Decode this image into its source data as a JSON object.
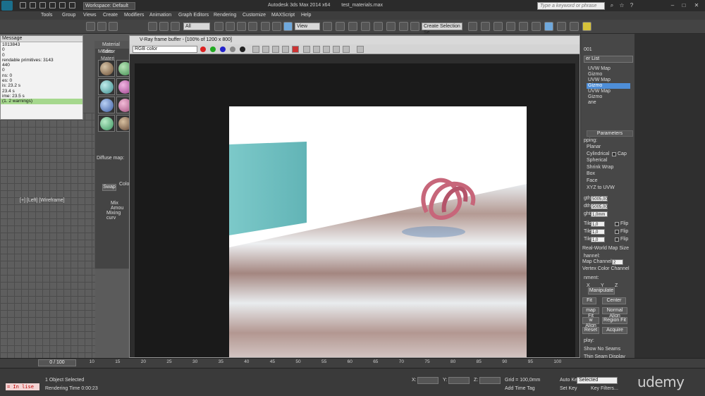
{
  "titlebar": {
    "workspace": "Workspace: Default",
    "title": "Autodesk 3ds Max 2014 x64",
    "file": "test_materials.max",
    "search_placeholder": "Type a keyword or phrase"
  },
  "menu": [
    "Tools",
    "Group",
    "Views",
    "Create",
    "Modifiers",
    "Animation",
    "Graph Editors",
    "Rendering",
    "Customize",
    "MAXScript",
    "Help"
  ],
  "toolbar": {
    "filter": "All",
    "ref_coord": "View",
    "selection_set": "Create Selection Se"
  },
  "message_window": {
    "title": "Message",
    "lines": [
      "1013843",
      "0",
      "0",
      "rendable primitives: 3143",
      "440",
      "0",
      "ns: 0",
      "es: 0",
      "is: 23.2 s",
      "23.4 s",
      "ime: 23.5 s",
      "(1. 2 warnings)"
    ],
    "highlight_index": 11
  },
  "material_editor": {
    "title": "Material Editor",
    "tabs": [
      "Modes",
      "Materi"
    ],
    "diffuse_label": "Diffuse map:",
    "swap_label": "Swap",
    "color_label": "Colo",
    "mix_amount_label": "Mix Amou",
    "mixing_curve_label": "Mixing curv"
  },
  "vfb": {
    "title": "V-Ray frame buffer - [100% of 1200 x 800]",
    "channel": "RGB color"
  },
  "viewport": {
    "label": "[+] [Left] [Wireframe]"
  },
  "command_panel": {
    "object_name": "001",
    "modifier_list": "er List",
    "stack": [
      {
        "label": "UVW Map",
        "selected": false
      },
      {
        "label": "Gizmo",
        "selected": false
      },
      {
        "label": "UVW Map",
        "selected": true
      },
      {
        "label": "Gizmo",
        "selected": true
      },
      {
        "label": "UVW Map",
        "selected": false
      },
      {
        "label": "Gizmo",
        "selected": false
      },
      {
        "label": "ane",
        "selected": false
      }
    ],
    "parameters_title": "Parameters",
    "mapping_label": "pping:",
    "mapping_options": [
      "Planar",
      "Cylindrical",
      "Spherical",
      "Shrink Wrap",
      "Box",
      "Face",
      "XYZ to UVW"
    ],
    "cap_label": "Cap",
    "length_label": "gth:",
    "length_value": "5005,00",
    "width_label": "dth:",
    "width_value": "5005,00",
    "height_label": "ght:",
    "height_value": "1,0mm",
    "u_tile_label": "Tile:",
    "u_tile_value": "1,0",
    "v_tile_label": "Tile:",
    "v_tile_value": "1,0",
    "w_tile_label": "Tile:",
    "w_tile_value": "1,0",
    "flip_label": "Flip",
    "real_world": "Real-World Map Size",
    "channel_label": "hannel:",
    "map_channel_label": "Map Channel:",
    "map_channel_value": "2",
    "vertex_color_channel": "Vertex Color Channel",
    "alignment_label": "nment:",
    "axes": [
      "X",
      "Y",
      "Z"
    ],
    "manipulate": "Manipulate",
    "fit": "Fit",
    "center": "Center",
    "bitmap_fit": "map Fit",
    "normal_align": "Normal Align",
    "view_align": "w Align",
    "region_fit": "Region Fit",
    "reset": "Reset",
    "acquire": "Acquire",
    "display_label": "play:",
    "display_options": [
      "Show No Seams",
      "Thin Seam Display",
      "Thick Seam Display"
    ]
  },
  "timeline": {
    "frame": "0 / 100",
    "ticks": [
      "5",
      "10",
      "15",
      "20",
      "25",
      "30",
      "35",
      "40",
      "45",
      "50",
      "55",
      "60",
      "65",
      "70",
      "75",
      "80",
      "85",
      "90",
      "95",
      "100"
    ]
  },
  "statusbar": {
    "maxscript": "= In lise",
    "selection": "1 Object Selected",
    "render_time": "Rendering Time  0:00:23",
    "x_label": "X:",
    "y_label": "Y:",
    "z_label": "Z:",
    "grid": "Grid = 100,0mm",
    "add_time_tag": "Add Time Tag",
    "auto_key": "Auto Key",
    "auto_key_mode": "Selected",
    "set_key": "Set Key",
    "key_filters": "Key Filters..."
  },
  "watermark": "udemy"
}
